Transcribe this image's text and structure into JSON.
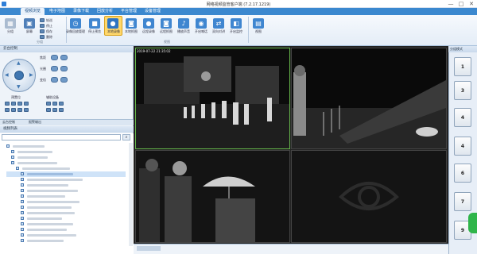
{
  "window": {
    "title": "网络视频监管客户端 (7.2.17.1219)",
    "min": "—",
    "max": "□",
    "close": "✕"
  },
  "tabs": [
    {
      "label": "视频浏览",
      "active": true
    },
    {
      "label": "电子地图"
    },
    {
      "label": "录像下载"
    },
    {
      "label": "回放分析"
    },
    {
      "label": "平台管理"
    },
    {
      "label": "设备管理"
    }
  ],
  "ribbon": {
    "groups": [
      {
        "label": "分组"
      },
      {
        "label": "视图"
      }
    ],
    "buttons": [
      {
        "label": "分组",
        "icon": "group-icon",
        "color": "#4f7fb8"
      },
      {
        "label": "屏幕",
        "icon": "screen-icon",
        "color": "#4f7fb8"
      },
      {
        "label": "最大化",
        "icon": "maximize-icon",
        "color": "#4f7fb8"
      },
      {
        "label": "录像回放管理",
        "icon": "playback-icon",
        "color": "#3f86d0"
      },
      {
        "label": "停止预览",
        "icon": "stop-icon",
        "color": "#3f86d0"
      },
      {
        "label": "本地录像",
        "icon": "record-icon",
        "color": "#2e74c3"
      },
      {
        "label": "本地抓图",
        "icon": "camera-icon",
        "color": "#3f86d0"
      },
      {
        "label": "远程录像",
        "icon": "remote-record-icon",
        "color": "#3f86d0"
      },
      {
        "label": "远程抓图",
        "icon": "remote-snap-icon",
        "color": "#3f86d0"
      },
      {
        "label": "播放声音",
        "icon": "sound-icon",
        "color": "#3f86d0"
      },
      {
        "label": "开启喊话",
        "icon": "talk-icon",
        "color": "#3f86d0"
      },
      {
        "label": "双向对讲",
        "icon": "intercom-icon",
        "color": "#3f86d0"
      },
      {
        "label": "开启监控",
        "icon": "monitor-icon",
        "color": "#3f86d0"
      },
      {
        "label": "视图",
        "icon": "view-icon",
        "color": "#3f86d0"
      }
    ],
    "small": [
      {
        "label": "轮巡"
      },
      {
        "label": "停止"
      },
      {
        "label": "保存"
      },
      {
        "label": "删除"
      }
    ]
  },
  "tooltip": "启动/结束本地录像",
  "ptz": {
    "header": "云台控制",
    "labels": [
      "焦距",
      "光圈",
      "变倍"
    ],
    "preset": "预置位",
    "aux": "辅助设备"
  },
  "tree": {
    "tabs": [
      "云台控制",
      "报警输出"
    ],
    "header": "视频列表",
    "search_placeholder": ""
  },
  "right_panel": {
    "header": "分组模式",
    "buttons": [
      "1",
      "3",
      "4",
      "4",
      "6",
      "7",
      "9"
    ]
  },
  "video": {
    "timestamps": [
      "2019-07-22 21:35:02",
      "",
      "",
      ""
    ]
  },
  "colors": {
    "accent": "#3b88cf",
    "selected": "#66b84a"
  }
}
